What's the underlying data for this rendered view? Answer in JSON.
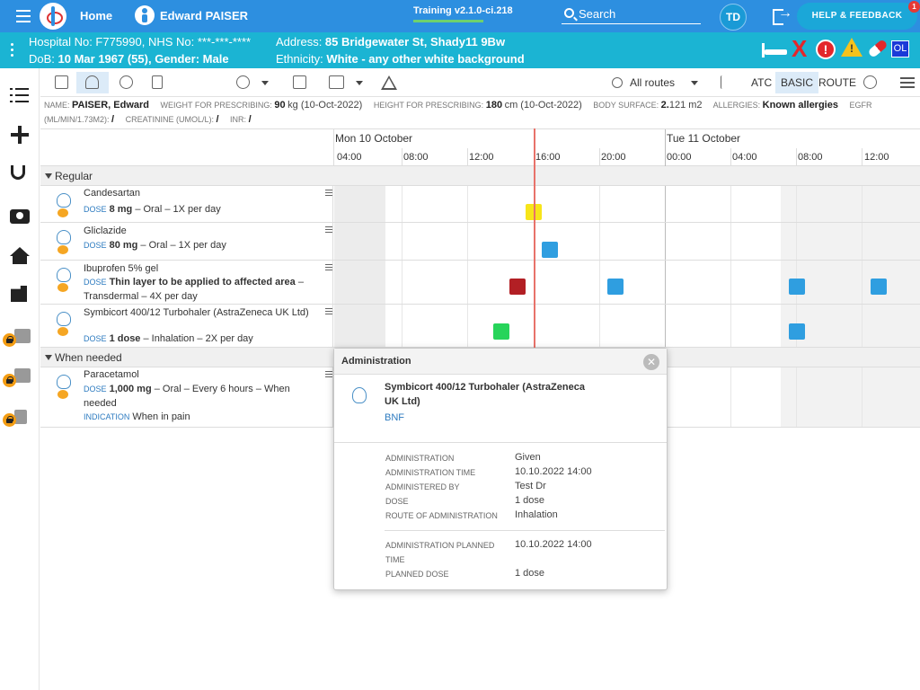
{
  "topbar": {
    "home": "Home",
    "patient_name": "Edward PAISER",
    "version": "Training v2.1.0-ci.218",
    "search_label": "Search",
    "avatar": "TD",
    "help": "HELP & FEEDBACK",
    "notification_count": "1"
  },
  "banner": {
    "hospital_line": "Hospital No: F775990, NHS No: ***-***-****",
    "dob_line_label": "DoB: ",
    "dob_value": "10 Mar 1967 (55), Gender: Male",
    "address_label": "Address: ",
    "address_value": "85 Bridgewater St, Shady11 9Bw",
    "ethnicity_label": "Ethnicity: ",
    "ethnicity_value": "White - any other white background",
    "icons": [
      "bed-icon",
      "red-x-icon",
      "alert-icon",
      "warning-icon",
      "pill-icon",
      "ol-badge"
    ],
    "x_glyph": "X",
    "alert_glyph": "!",
    "warning_glyph": "!",
    "ol": "OL"
  },
  "toolbar": {
    "routes": "All routes",
    "atc": "ATC",
    "basic": "BASIC",
    "route": "ROUTE"
  },
  "info": {
    "name_k": "Name:",
    "name_v": "PAISER, Edward",
    "weight_k": "Weight for prescribing:",
    "weight_v": "90",
    "weight_u": "kg (10-Oct-2022)",
    "height_k": "Height for prescribing:",
    "height_v": "180",
    "height_u": "cm (10-Oct-2022)",
    "bs_k": "Body surface:",
    "bs_v": "2.",
    "bs_u": "121 m2",
    "allergies_k": "Allergies:",
    "allergies_v": "Known allergies",
    "egfr_k": "eGFR (mL/min/1.73m2):",
    "egfr_v": "/",
    "creat_k": "Creatinine (umol/L):",
    "creat_v": "/",
    "inr_k": "INR:",
    "inr_v": "/"
  },
  "timeline": {
    "day1": "Mon 10 October",
    "day2": "Tue 11 October",
    "hours": [
      "04:00",
      "08:00",
      "12:00",
      "16:00",
      "20:00",
      "00:00",
      "04:00",
      "08:00",
      "12:00"
    ]
  },
  "groups": {
    "regular": "Regular",
    "when_needed": "When needed"
  },
  "dose_key": "DOSE",
  "indication_key": "INDICATION",
  "meds": [
    {
      "name": "Candesartan",
      "dose_bold": "8 mg",
      "dose_rest": " – Oral – 1X per day",
      "marks": [
        "#f7e51a"
      ]
    },
    {
      "name": "Gliclazide",
      "dose_bold": "80 mg",
      "dose_rest": " – Oral – 1X per day",
      "marks": [
        "#2f9ee0"
      ]
    },
    {
      "name": "Ibuprofen 5% gel",
      "dose_bold": "Thin layer to be applied to affected area",
      "dose_rest": " – Transdermal – 4X per day",
      "marks": [
        "#b21f24",
        "#2f9ee0",
        "#2f9ee0",
        "#2f9ee0"
      ]
    },
    {
      "name": "Symbicort 400/12 Turbohaler (AstraZeneca UK Ltd)",
      "dose_bold": "1 dose",
      "dose_rest": " – Inhalation – 2X per day",
      "marks": [
        "#27d45a",
        "#2f9ee0"
      ]
    },
    {
      "name": "Paracetamol",
      "dose_bold": "1,000 mg",
      "dose_rest": " – Oral – Every 6 hours – When needed",
      "indication": "When in pain"
    }
  ],
  "popup": {
    "title": "Administration",
    "close": "✕",
    "drug": "Symbicort 400/12 Turbohaler (AstraZeneca UK Ltd)",
    "bnf": "BNF",
    "rows": [
      {
        "k": "Administration",
        "v": "Given"
      },
      {
        "k": "Administration time",
        "v": "10.10.2022 14:00"
      },
      {
        "k": "Administered by",
        "v": "Test Dr"
      },
      {
        "k": "Dose",
        "v": "1 dose"
      },
      {
        "k": "Route of administration",
        "v": "Inhalation"
      },
      {
        "k": "Administration planned time",
        "v": "10.10.2022 14:00"
      },
      {
        "k": "Planned dose",
        "v": "1 dose"
      }
    ]
  }
}
